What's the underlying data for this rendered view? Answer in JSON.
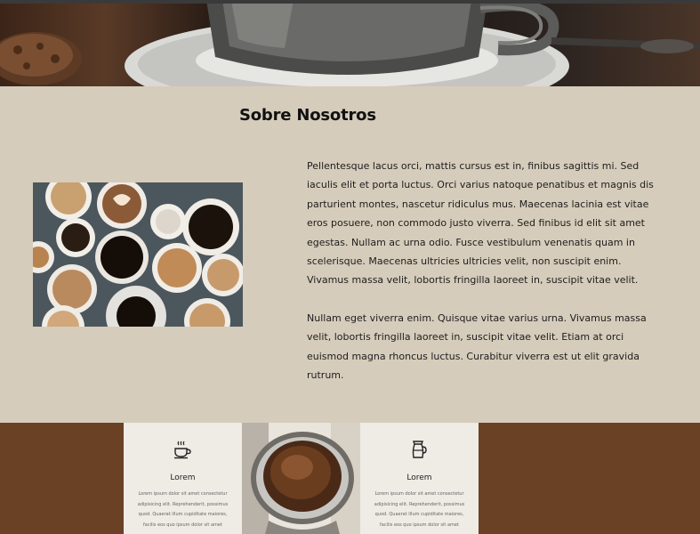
{
  "about": {
    "title": "Sobre Nosotros",
    "paragraphs": [
      "Pellentesque lacus orci, mattis cursus est in, finibus sagittis mi. Sed iaculis elit et porta luctus. Orci varius natoque penatibus et magnis dis parturient montes, nascetur ridiculus mus. Maecenas lacinia est vitae eros posuere, non commodo justo viverra. Sed finibus id elit sit amet egestas. Nullam ac urna odio. Fusce vestibulum venenatis quam in scelerisque. Maecenas ultricies ultricies velit, non suscipit enim. Vivamus massa velit, lobortis fringilla laoreet in, suscipit vitae velit.",
      "Nullam eget viverra enim. Quisque vitae varius urna. Vivamus massa velit, lobortis fringilla laoreet in, suscipit vitae velit. Etiam at orci euismod magna rhoncus luctus. Curabitur viverra est ut elit gravida rutrum."
    ]
  },
  "features": [
    {
      "icon": "coffee-cup-icon",
      "title": "Lorem",
      "text": "Lorem ipsum dolor sit amet consectetur adipisicing elit. Reprehenderit, possimus quod. Quaerat illum cupiditate maiores, facilis eos quo ipsum dolor sit amet"
    },
    {
      "icon": "coffee-pot-icon",
      "title": "Lorem",
      "text": "Lorem ipsum dolor sit amet consectetur adipisicing elit. Reprehenderit, possimus quod. Quaerat illum cupiditate maiores, facilis eos quo ipsum dolor sit amet"
    }
  ],
  "colors": {
    "about_bg": "#d6ccbb",
    "band_bg": "#6b4125",
    "card_bg": "#efebe5"
  }
}
